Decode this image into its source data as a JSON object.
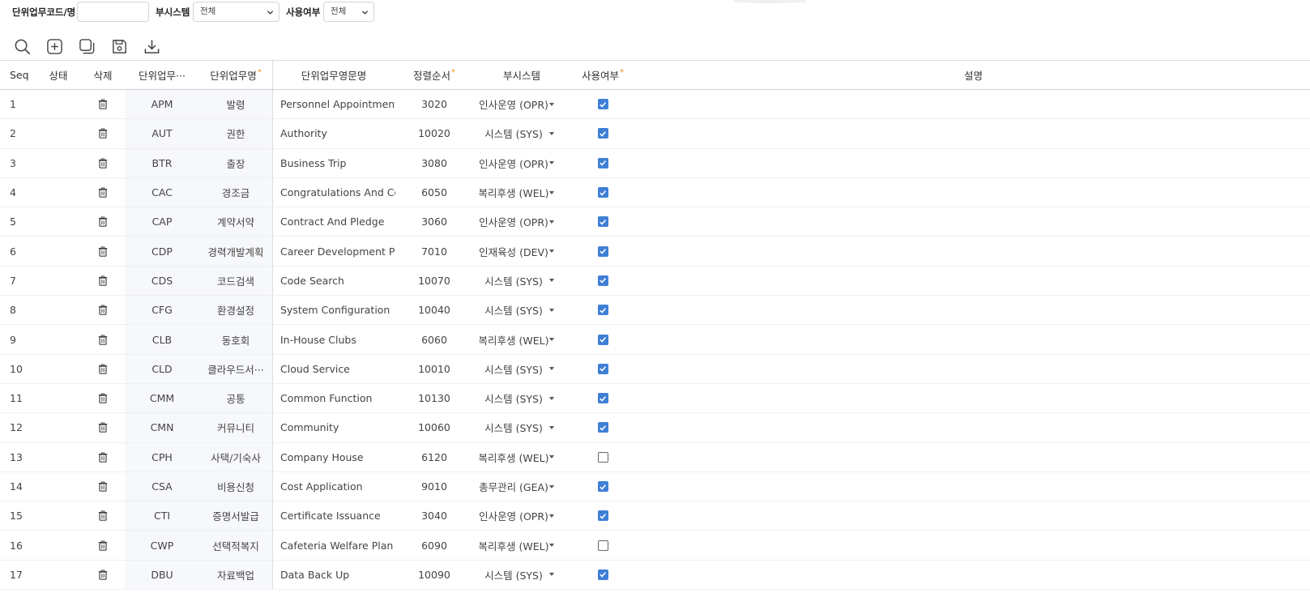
{
  "filter": {
    "code_label": "단위업무코드/명",
    "code_value": "",
    "subsystem_label": "부시스템",
    "subsystem_value": "전체",
    "use_label": "사용여부",
    "use_value": "전체"
  },
  "toolbar": {
    "search_icon": "search-icon",
    "add_icon": "add-icon",
    "copy_icon": "copy-icon",
    "save_icon": "save-icon",
    "download_icon": "download-icon"
  },
  "colors": {
    "required_mark": "#f28c1a",
    "checkbox_on": "#3f7fd6"
  },
  "grid": {
    "headers": {
      "seq": "Seq",
      "state": "상태",
      "delete": "삭제",
      "code": "단위업무···",
      "name": "단위업무명",
      "eng_name": "단위업무영문명",
      "sort_order": "정렬순서",
      "subsystem": "부시스템",
      "use": "사용여부",
      "desc": "설명"
    },
    "required_mark": "*",
    "rows": [
      {
        "seq": "1",
        "code": "APM",
        "name": "발령",
        "eng": "Personnel Appointments",
        "order": "3020",
        "sub": "인사운영 (OPR)",
        "use": true
      },
      {
        "seq": "2",
        "code": "AUT",
        "name": "권한",
        "eng": "Authority",
        "order": "10020",
        "sub": "시스템 (SYS)",
        "use": true
      },
      {
        "seq": "3",
        "code": "BTR",
        "name": "출장",
        "eng": "Business Trip",
        "order": "3080",
        "sub": "인사운영 (OPR)",
        "use": true
      },
      {
        "seq": "4",
        "code": "CAC",
        "name": "경조금",
        "eng": "Congratulations And Con···",
        "order": "6050",
        "sub": "복리후생 (WEL)",
        "use": true
      },
      {
        "seq": "5",
        "code": "CAP",
        "name": "계약서약",
        "eng": "Contract And Pledge",
        "order": "3060",
        "sub": "인사운영 (OPR)",
        "use": true
      },
      {
        "seq": "6",
        "code": "CDP",
        "name": "경력개발계획",
        "eng": "Career Development Pla···",
        "order": "7010",
        "sub": "인재육성 (DEV)",
        "use": true
      },
      {
        "seq": "7",
        "code": "CDS",
        "name": "코드검색",
        "eng": "Code Search",
        "order": "10070",
        "sub": "시스템 (SYS)",
        "use": true
      },
      {
        "seq": "8",
        "code": "CFG",
        "name": "환경설정",
        "eng": "System Configuration",
        "order": "10040",
        "sub": "시스템 (SYS)",
        "use": true
      },
      {
        "seq": "9",
        "code": "CLB",
        "name": "동호회",
        "eng": "In-House Clubs",
        "order": "6060",
        "sub": "복리후생 (WEL)",
        "use": true
      },
      {
        "seq": "10",
        "code": "CLD",
        "name": "클라우드서···",
        "eng": "Cloud Service",
        "order": "10010",
        "sub": "시스템 (SYS)",
        "use": true
      },
      {
        "seq": "11",
        "code": "CMM",
        "name": "공통",
        "eng": "Common Function",
        "order": "10130",
        "sub": "시스템 (SYS)",
        "use": true
      },
      {
        "seq": "12",
        "code": "CMN",
        "name": "커뮤니티",
        "eng": "Community",
        "order": "10060",
        "sub": "시스템 (SYS)",
        "use": true
      },
      {
        "seq": "13",
        "code": "CPH",
        "name": "사택/기숙사",
        "eng": "Company House",
        "order": "6120",
        "sub": "복리후생 (WEL)",
        "use": false
      },
      {
        "seq": "14",
        "code": "CSA",
        "name": "비용신청",
        "eng": "Cost Application",
        "order": "9010",
        "sub": "총무관리 (GEA)",
        "use": true
      },
      {
        "seq": "15",
        "code": "CTI",
        "name": "증명서발급",
        "eng": "Certificate Issuance",
        "order": "3040",
        "sub": "인사운영 (OPR)",
        "use": true
      },
      {
        "seq": "16",
        "code": "CWP",
        "name": "선택적복지",
        "eng": "Cafeteria Welfare Plan",
        "order": "6090",
        "sub": "복리후생 (WEL)",
        "use": false
      },
      {
        "seq": "17",
        "code": "DBU",
        "name": "자료백업",
        "eng": "Data Back Up",
        "order": "10090",
        "sub": "시스템 (SYS)",
        "use": true
      }
    ]
  }
}
